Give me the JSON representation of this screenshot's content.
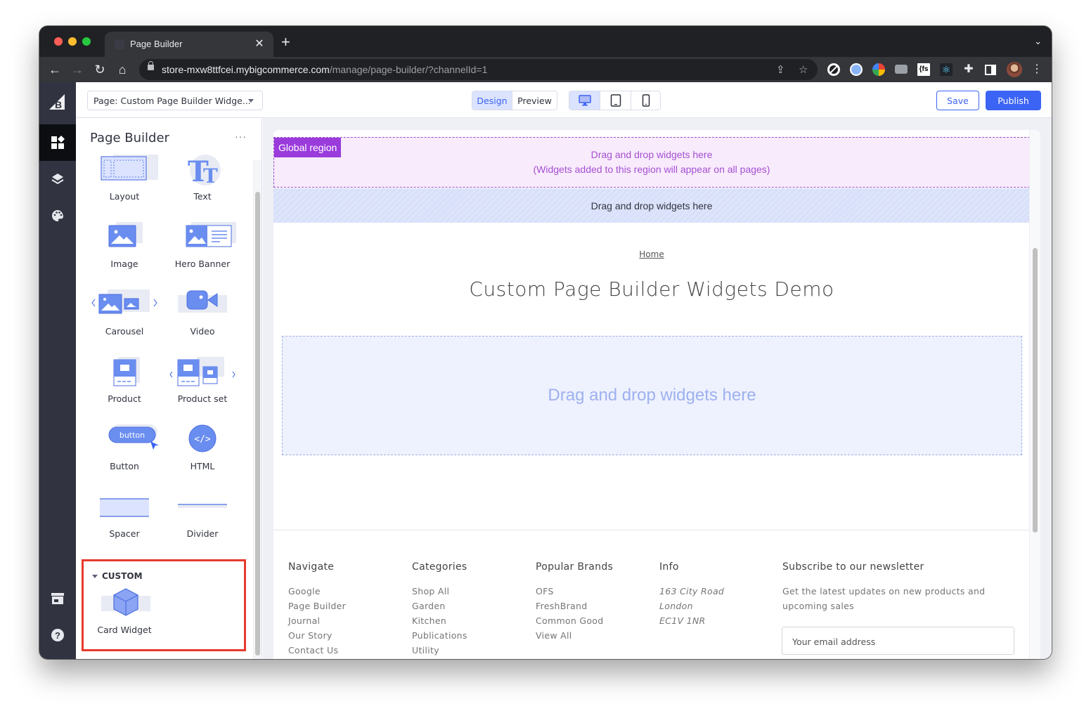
{
  "browser": {
    "tab_title": "Page Builder",
    "url_host": "store-mxw8ttfcei.mybigcommerce.com",
    "url_path": "/manage/page-builder/?channelId=1",
    "extensions": [
      "ad-block-icon",
      "lastpass-icon",
      "google-photos-icon",
      "camera-icon",
      "fullstory-icon",
      "react-devtools-icon",
      "extensions-puzzle-icon",
      "side-panel-icon",
      "profile-avatar",
      "more-menu-icon"
    ]
  },
  "topbar": {
    "page_select": "Page: Custom Page Builder Widge...",
    "mode_tabs": [
      {
        "label": "Design",
        "active": true
      },
      {
        "label": "Preview",
        "active": false
      }
    ],
    "devices": [
      {
        "name": "desktop",
        "active": true
      },
      {
        "name": "tablet",
        "active": false
      },
      {
        "name": "mobile",
        "active": false
      }
    ],
    "save_label": "Save",
    "publish_label": "Publish",
    "accent": "#3c64f4"
  },
  "leftnav": {
    "items": [
      "widgets",
      "layers",
      "theme-styles",
      "storefront",
      "help"
    ],
    "active": "widgets"
  },
  "panel": {
    "title": "Page Builder",
    "more": "···",
    "widgets": [
      {
        "label": "Layout"
      },
      {
        "label": "Text"
      },
      {
        "label": "Image"
      },
      {
        "label": "Hero Banner"
      },
      {
        "label": "Carousel"
      },
      {
        "label": "Video"
      },
      {
        "label": "Product"
      },
      {
        "label": "Product set"
      },
      {
        "label": "Button",
        "icon_text": "button"
      },
      {
        "label": "HTML"
      },
      {
        "label": "Spacer"
      },
      {
        "label": "Divider"
      }
    ],
    "custom_section": {
      "title": "CUSTOM",
      "widgets": [
        {
          "label": "Card Widget"
        }
      ]
    }
  },
  "canvas": {
    "global_region": {
      "tag": "Global region",
      "line1": "Drag and drop widgets here",
      "line2": "(Widgets added to this region will appear on all pages)"
    },
    "header_region": "Drag and drop widgets here",
    "breadcrumb": "Home",
    "page_title": "Custom Page Builder Widgets Demo",
    "main_drop": "Drag and drop widgets here",
    "footer": {
      "navigate": {
        "title": "Navigate",
        "links": [
          "Google",
          "Page Builder",
          "Journal",
          "Our Story",
          "Contact Us"
        ]
      },
      "categories": {
        "title": "Categories",
        "links": [
          "Shop All",
          "Garden",
          "Kitchen",
          "Publications",
          "Utility"
        ]
      },
      "brands": {
        "title": "Popular Brands",
        "links": [
          "OFS",
          "FreshBrand",
          "Common Good",
          "View All"
        ]
      },
      "info": {
        "title": "Info",
        "lines": [
          "163 City Road",
          "London",
          "EC1V 1NR"
        ]
      },
      "newsletter": {
        "title": "Subscribe to our newsletter",
        "text1": "Get the latest updates on new products and",
        "text2": "upcoming sales",
        "placeholder": "Your email address"
      }
    }
  }
}
